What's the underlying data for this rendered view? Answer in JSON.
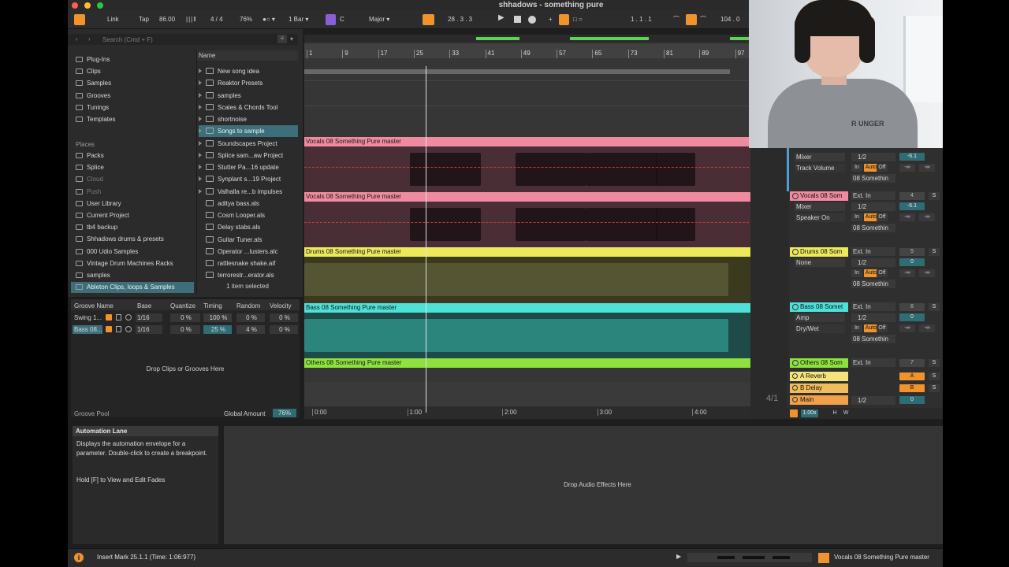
{
  "window": {
    "title": "shhadows - something pure"
  },
  "transport": {
    "link": "Link",
    "tap": "Tap",
    "tempo": "86.00",
    "signature": "4 / 4",
    "cpu": "76%",
    "quantize": "1 Bar",
    "key_root": "C",
    "key_scale": "Major",
    "position": "28 .  3 .  3",
    "loop_start": "1 .  1 .  1",
    "loop_length": "104 .  0"
  },
  "browser": {
    "search_placeholder": "Search (Cmd + F)",
    "places_header": "Places",
    "collections": [
      "Plug-Ins",
      "Clips",
      "Samples",
      "Grooves",
      "Tunings",
      "Templates"
    ],
    "places": [
      "Packs",
      "Splice",
      "Cloud",
      "Push",
      "User Library",
      "Current Project",
      "tb4 backup",
      "Shhadows drums & presets",
      "000 Udio Samples",
      "Vintage Drum Machines Racks",
      "samples",
      "Ableton Clips, loops & Samples"
    ],
    "name_header": "Name",
    "files": [
      "New song idea",
      "Reaktor Presets",
      "samples",
      "Scales & Chords Tool",
      "shortnoise",
      "Songs to sample",
      "Soundscapes Project",
      "Splice sam...aw Project",
      "Stutter Pa...16 update",
      "Synplant s...19 Project",
      "Valhalla re...b impulses",
      "aditya bass.als",
      "Cosm Looper.als",
      "Delay stabs.als",
      "Guitar Tuner.als",
      "Operator ...lusters.alc",
      "rattlesnake shake.aif",
      "terrorestr...erator.als"
    ],
    "selection_status": "1 item selected"
  },
  "groove_pool": {
    "headers": [
      "Groove Name",
      "Base",
      "Quantize",
      "Timing",
      "Random",
      "Velocity"
    ],
    "rows": [
      {
        "name": "Swing 1...",
        "base": "1/16",
        "quantize": "0 %",
        "timing": "100 %",
        "random": "0 %",
        "velocity": "0 %"
      },
      {
        "name": "Bass 08...",
        "base": "1/16",
        "quantize": "0 %",
        "timing": "25 %",
        "random": "4 %",
        "velocity": "0 %"
      }
    ],
    "drop_hint": "Drop Clips or Grooves Here",
    "title": "Groove Pool",
    "global_amount_label": "Global Amount",
    "global_amount": "76%"
  },
  "arrangement": {
    "ruler_bars": [
      "1",
      "9",
      "17",
      "25",
      "33",
      "41",
      "49",
      "57",
      "65",
      "73",
      "81",
      "89",
      "97"
    ],
    "time_ruler": [
      "0:00",
      "1:00",
      "2:00",
      "3:00",
      "4:00"
    ],
    "time_signature_badge": "4/1",
    "clips": [
      {
        "name": "Vocals 08 Something Pure master",
        "color": "#f08aa0"
      },
      {
        "name": "Vocals 08 Something Pure master",
        "color": "#f08aa0"
      },
      {
        "name": "Drums 08 Something Pure master",
        "color": "#ecea5a",
        "tail": "Drums 08 S"
      },
      {
        "name": "Bass 08 Something Pure master",
        "color": "#4fe0d8"
      },
      {
        "name": "Others 08 Something Pure master",
        "color": "#8ee23e"
      }
    ]
  },
  "mixer": {
    "tracks": [
      {
        "name": "",
        "color": "#f08aa0",
        "device": "Mixer",
        "param": "Track Volume",
        "input": "1/2",
        "monitor": [
          "In",
          "Auto",
          "Off"
        ],
        "output": "08 Somethin",
        "volume": "-6.1",
        "sends": [
          "-∞",
          "-∞"
        ]
      },
      {
        "name": "Vocals 08 Som",
        "color": "#f08aa0",
        "input_type": "Ext. In",
        "device": "Mixer",
        "param": "Speaker On",
        "input": "1/2",
        "monitor": [
          "In",
          "Auto",
          "Off"
        ],
        "output": "08 Somethin",
        "number": "4",
        "volume": "-6.1",
        "sends": [
          "-∞",
          "-∞"
        ]
      },
      {
        "name": "Drums 08 Som",
        "color": "#ecea5a",
        "input_type": "Ext. In",
        "device": "None",
        "param": "",
        "input": "1/2",
        "monitor": [
          "In",
          "Auto",
          "Off"
        ],
        "output": "08 Somethin",
        "number": "5",
        "volume": "0",
        "sends": [
          "-∞",
          "-∞"
        ]
      },
      {
        "name": "Bass 08 Somet",
        "color": "#4fe0d8",
        "input_type": "Ext. In",
        "device": "Amp",
        "param": "Dry/Wet",
        "input": "1/2",
        "monitor": [
          "In",
          "Auto",
          "Off"
        ],
        "output": "08 Somethin",
        "number": "6",
        "volume": "0",
        "sends": [
          "-∞",
          "-∞"
        ]
      },
      {
        "name": "Others 08 Som",
        "color": "#8ee23e",
        "input_type": "Ext. In",
        "number": "7"
      }
    ],
    "returns": [
      {
        "name": "A Reverb",
        "color": "#f3e47a",
        "letter": "A"
      },
      {
        "name": "B Delay",
        "color": "#f0bd5a",
        "letter": "B"
      },
      {
        "name": "Main",
        "color": "#f0a14a",
        "input": "1/2",
        "volume": "0"
      }
    ],
    "solo": "S",
    "zoom": "1.00x",
    "h_label": "H",
    "w_label": "W"
  },
  "info_view": {
    "title": "Automation Lane",
    "body": "Displays the automation envelope for a parameter. Double-click to create a breakpoint.",
    "hint": "Hold [F] to View and Edit Fades"
  },
  "device_view": {
    "drop_hint": "Drop Audio Effects Here"
  },
  "status_bar": {
    "message": "Insert Mark 25.1.1 (Time: 1:06:977)",
    "selected_track": "Vocals 08 Something Pure master"
  },
  "webcam": {
    "shirt_text": "R UNGER"
  }
}
